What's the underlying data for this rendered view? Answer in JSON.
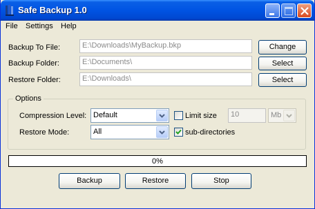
{
  "title": "Safe Backup 1.0",
  "menu": [
    "File",
    "Settings",
    "Help"
  ],
  "backup_to_file": {
    "label": "Backup To File:",
    "value": "E:\\Downloads\\MyBackup.bkp",
    "button": "Change"
  },
  "backup_folder": {
    "label": "Backup Folder:",
    "value": "E:\\Documents\\",
    "button": "Select"
  },
  "restore_folder": {
    "label": "Restore Folder:",
    "value": "E:\\Downloads\\",
    "button": "Select"
  },
  "options": {
    "group_title": "Options",
    "compression_label": "Compression Level:",
    "compression_value": "Default",
    "limit_size_label": "Limit size",
    "limit_size_checked": false,
    "limit_size_value": "10",
    "limit_size_unit": "Mb",
    "restore_mode_label": "Restore Mode:",
    "restore_mode_value": "All",
    "subdirectories_label": "sub-directories",
    "subdirectories_checked": true
  },
  "progress": {
    "percent": 0,
    "text": "0%"
  },
  "buttons": {
    "backup": "Backup",
    "restore": "Restore",
    "stop": "Stop"
  },
  "colors": {
    "titlebar": "#0054e3",
    "window_bg": "#ece9d8",
    "checkmark": "#21a121",
    "close_button": "#d84a20"
  }
}
